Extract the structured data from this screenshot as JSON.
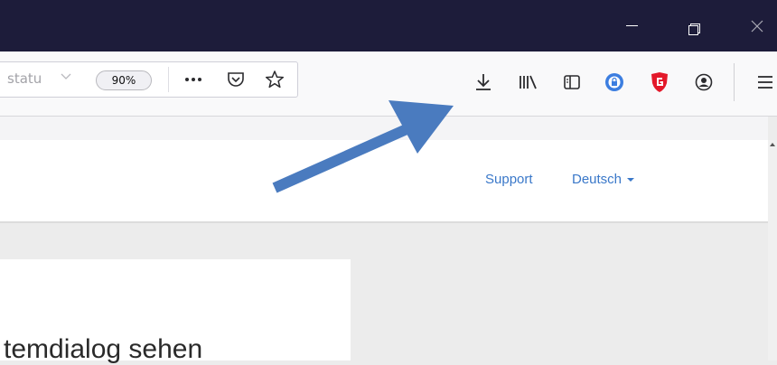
{
  "window_controls": {
    "minimize_icon": "minimize-icon",
    "restore_icon": "restore-icon",
    "close_icon": "close-icon"
  },
  "urlbar": {
    "text": "statu",
    "zoom": "90%",
    "page_actions": [
      "more-icon",
      "pocket-icon",
      "bookmark-star-icon"
    ]
  },
  "toolbar": {
    "icons": [
      "download-icon",
      "library-icon",
      "sidebar-icon",
      "lock-extension-icon",
      "gdata-shield-icon",
      "account-icon",
      "hamburger-menu-icon"
    ]
  },
  "site_nav": {
    "support": "Support",
    "language": "Deutsch"
  },
  "content": {
    "heading": "temdialog sehen"
  },
  "annotation": {
    "color": "#4a7bbf",
    "icon": "arrow-pointing-to-download"
  }
}
